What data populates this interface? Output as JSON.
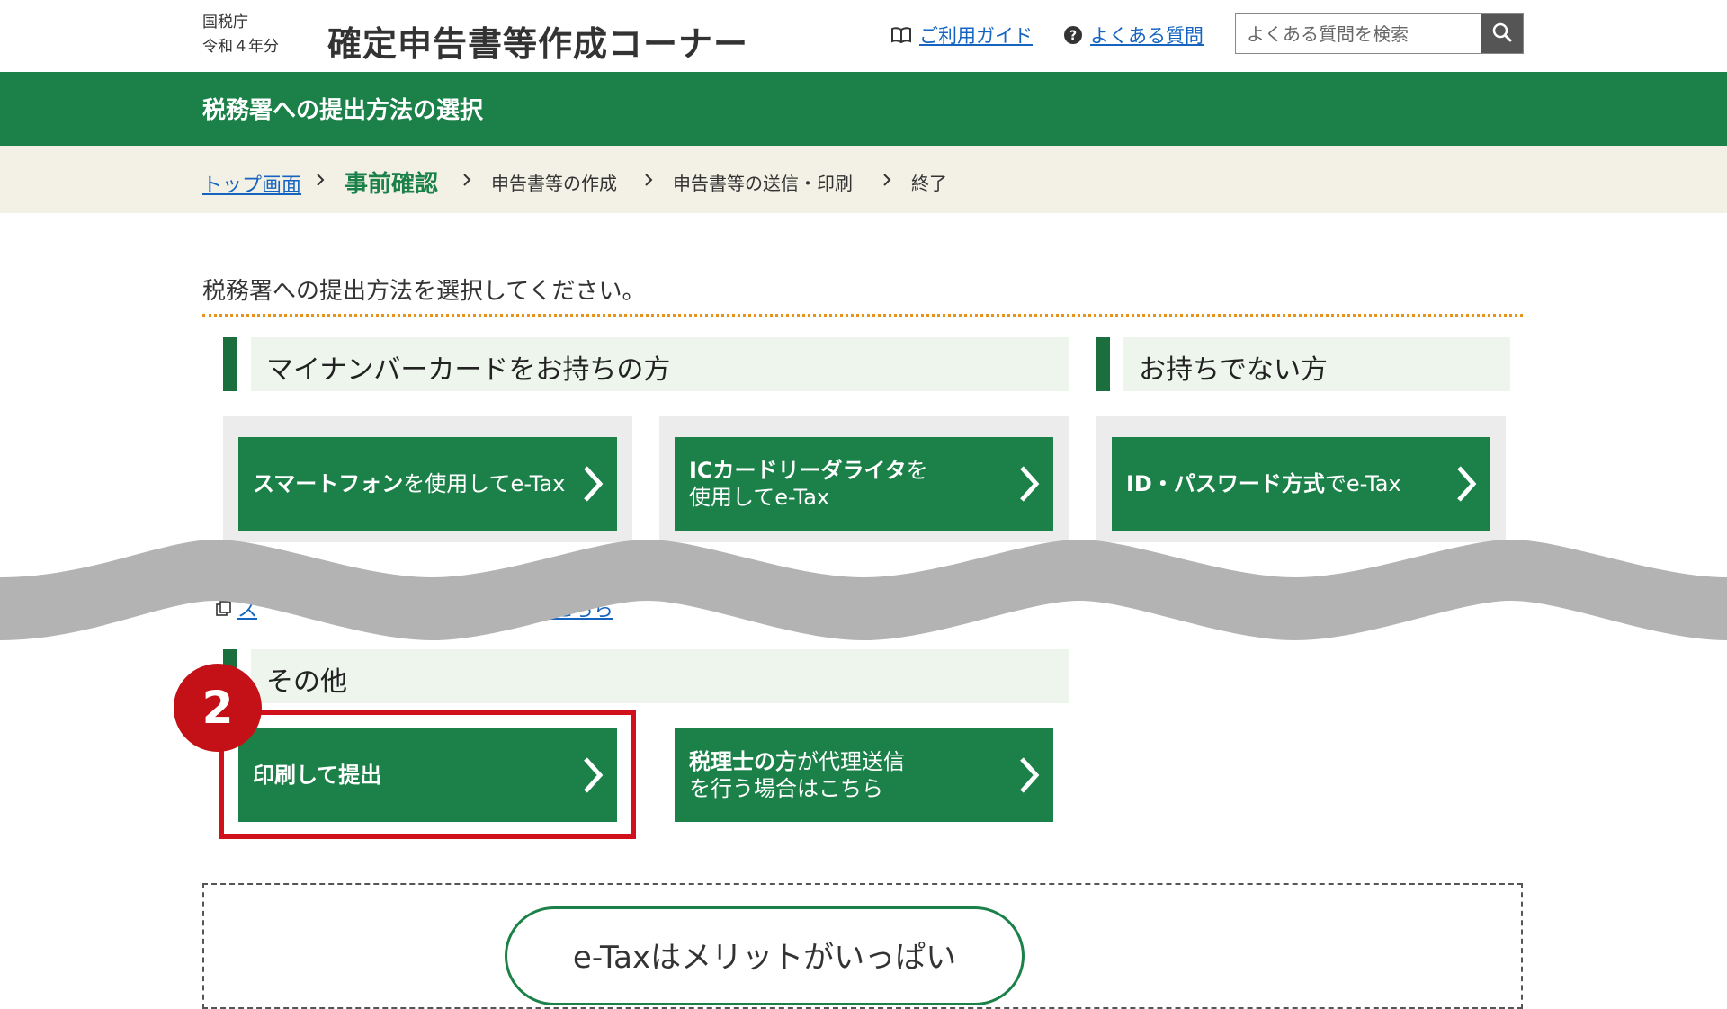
{
  "header": {
    "agency": "国税庁",
    "year": "令和４年分",
    "title": "確定申告書等作成コーナー",
    "guide_link": "ご利用ガイド",
    "faq_link": "よくある質問",
    "search_placeholder": "よくある質問を検索"
  },
  "title_bar": "税務署への提出方法の選択",
  "breadcrumb": {
    "top": "トップ画面",
    "current": "事前確認",
    "step3": "申告書等の作成",
    "step4": "申告書等の送信・印刷",
    "step5": "終了"
  },
  "instruction": "税務署への提出方法を選択してください。",
  "section_mynumber": {
    "title": "マイナンバーカードをお持ちの方",
    "btn_smartphone_bold": "スマートフォン",
    "btn_smartphone_rest": "を使用してe-Tax",
    "btn_icreader_bold": "ICカードリーダライタ",
    "btn_icreader_rest1": "を",
    "btn_icreader_rest2": "使用してe-Tax"
  },
  "section_nocard": {
    "title": "お持ちでない方",
    "btn_idpw_bold": "ID・パスワード方式",
    "btn_idpw_rest": "でe-Tax"
  },
  "partial_link": {
    "start": "ス",
    "end": "はこちら"
  },
  "section_other": {
    "title": "その他",
    "btn_print": "印刷して提出",
    "btn_taxacc_bold": "税理士の方",
    "btn_taxacc_rest1": "が代理送信",
    "btn_taxacc_rest2": "を行う場合はこちら"
  },
  "step_badge": "2",
  "promo": "e-Taxはメリットがいっぱい",
  "colors": {
    "primary_green": "#1b8149",
    "dark_green": "#1b6f3e",
    "badge_red": "#c41118",
    "link_blue": "#1565c0",
    "breadcrumb_bg": "#f3f0e6"
  }
}
